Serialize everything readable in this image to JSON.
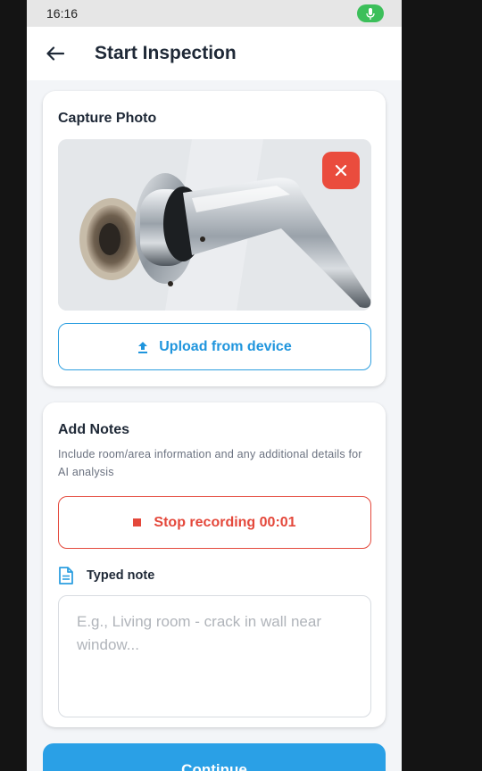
{
  "status_bar": {
    "time": "16:16",
    "mic_icon": "mic-icon",
    "mic_color": "#3cbf5a"
  },
  "app_bar": {
    "title": "Start Inspection",
    "back_icon": "arrow-left-icon"
  },
  "capture_card": {
    "title": "Capture Photo",
    "remove_icon": "close-icon",
    "upload_label": "Upload from device",
    "upload_icon": "upload-icon"
  },
  "notes_card": {
    "title": "Add Notes",
    "help": "Include room/area information and any additional details for AI analysis",
    "stop_label": "Stop recording 00:01",
    "typed_label": "Typed note",
    "typed_icon": "document-icon",
    "placeholder": "E.g., Living room - crack in wall near window...",
    "value": ""
  },
  "footer": {
    "continue_label": "Continue"
  },
  "colors": {
    "accent": "#2aa0e6",
    "danger": "#e4483b"
  }
}
